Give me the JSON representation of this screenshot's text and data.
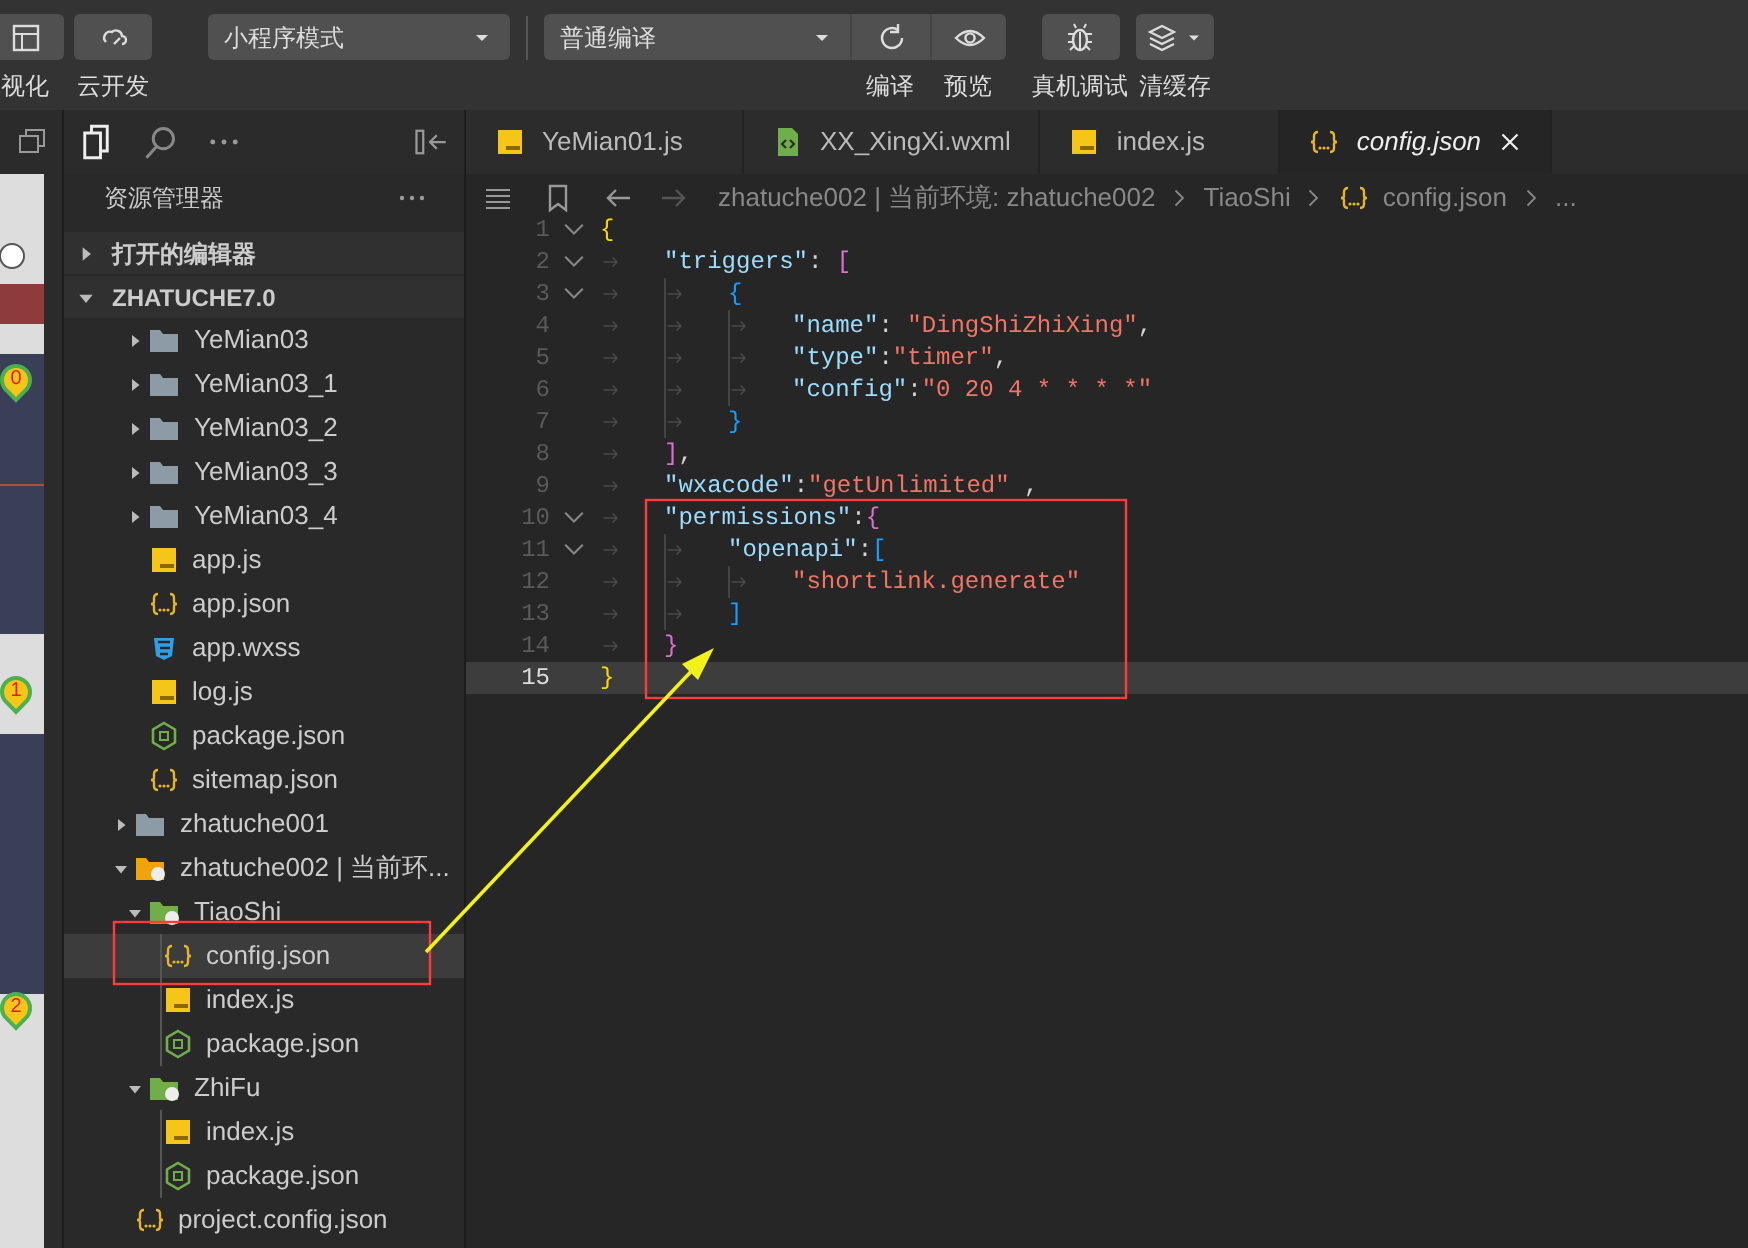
{
  "toolbar": {
    "tools": [
      {
        "kind": "button",
        "label": "视化"
      },
      {
        "kind": "button",
        "label": "云开发"
      },
      {
        "kind": "select",
        "value": "小程序模式"
      },
      {
        "kind": "compile",
        "value": "普通编译",
        "labels": [
          "编译",
          "预览"
        ]
      },
      {
        "kind": "button",
        "label": "真机调试"
      },
      {
        "kind": "button",
        "label": "清缓存"
      }
    ]
  },
  "simulator": {
    "markers": [
      "0",
      "1",
      "2"
    ]
  },
  "sidebar": {
    "title": "资源管理器",
    "sections": [
      {
        "label": "打开的编辑器",
        "expanded": false
      },
      {
        "label": "ZHATUCHE7.0",
        "expanded": true
      }
    ],
    "tree": [
      {
        "children": [
          {
            "label": "YeMian03",
            "kind": "folder",
            "expanded": false,
            "color": "#8d9ba6"
          },
          {
            "label": "YeMian03_1",
            "kind": "folder",
            "expanded": false,
            "color": "#8d9ba6"
          },
          {
            "label": "YeMian03_2",
            "kind": "folder",
            "expanded": false,
            "color": "#8d9ba6"
          },
          {
            "label": "YeMian03_3",
            "kind": "folder",
            "expanded": false,
            "color": "#8d9ba6"
          },
          {
            "label": "YeMian03_4",
            "kind": "folder",
            "expanded": false,
            "color": "#8d9ba6"
          },
          {
            "label": "app.js",
            "kind": "js"
          },
          {
            "label": "app.json",
            "kind": "json"
          },
          {
            "label": "app.wxss",
            "kind": "css"
          },
          {
            "label": "log.js",
            "kind": "js"
          },
          {
            "label": "package.json",
            "kind": "node"
          },
          {
            "label": "sitemap.json",
            "kind": "json"
          }
        ]
      },
      {
        "label": "zhatuche001",
        "kind": "folder",
        "expanded": false,
        "color": "#8d9ba6"
      },
      {
        "label": "zhatuche002 | 当前环...",
        "kind": "folder",
        "expanded": true,
        "color": "#f0a30a",
        "children": [
          {
            "label": "TiaoShi",
            "kind": "folder",
            "expanded": true,
            "color": "#6fae4a",
            "children": [
              {
                "label": "config.json",
                "kind": "json",
                "selected": true
              },
              {
                "label": "index.js",
                "kind": "js",
                "selected": false
              },
              {
                "label": "package.json",
                "kind": "node",
                "selected": false
              }
            ]
          },
          {
            "label": "ZhiFu",
            "kind": "folder",
            "expanded": true,
            "color": "#6fae4a",
            "children": [
              {
                "label": "index.js",
                "kind": "js",
                "selected": false
              },
              {
                "label": "package.json",
                "kind": "node",
                "selected": false
              }
            ]
          }
        ]
      },
      {
        "label": "project.config.json",
        "kind": "json"
      }
    ]
  },
  "tabs": [
    {
      "label": "YeMian01.js",
      "kind": "js",
      "selected": false
    },
    {
      "label": "XX_XingXi.wxml",
      "kind": "wxml",
      "selected": false
    },
    {
      "label": "index.js",
      "kind": "js",
      "selected": false
    },
    {
      "label": "config.json",
      "kind": "json",
      "selected": true
    }
  ],
  "breadcrumb": [
    {
      "label": "zhatuche002 | 当前环境: zhatuche002"
    },
    {
      "label": "TiaoShi"
    },
    {
      "label": "config.json",
      "kind": "json"
    },
    {
      "label": "..."
    }
  ],
  "editor": {
    "lines": [
      {
        "number": "1",
        "fold": true,
        "current": false,
        "tokens": [
          {
            "kind": "bracket",
            "text": "{",
            "color": "#ffd700"
          }
        ],
        "children": [
          {
            "number": "2",
            "fold": true,
            "current": false,
            "tokens": [
              {
                "kind": "key",
                "text": "\"triggers\""
              },
              {
                "kind": "punct",
                "text": ": "
              },
              {
                "kind": "bracket",
                "text": "[",
                "color": "#da70d6"
              }
            ],
            "children": [
              {
                "number": "3",
                "fold": true,
                "current": false,
                "tokens": [
                  {
                    "kind": "bracket",
                    "text": "{",
                    "color": "#179fff"
                  }
                ],
                "children": [
                  {
                    "number": "4",
                    "fold": false,
                    "current": false,
                    "tokens": [
                      {
                        "kind": "key",
                        "text": "\"name\""
                      },
                      {
                        "kind": "punct",
                        "text": ": "
                      },
                      {
                        "kind": "string",
                        "text": "\"DingShiZhiXing\""
                      },
                      {
                        "kind": "punct",
                        "text": ","
                      }
                    ]
                  },
                  {
                    "number": "5",
                    "fold": false,
                    "current": false,
                    "tokens": [
                      {
                        "kind": "key",
                        "text": "\"type\""
                      },
                      {
                        "kind": "punct",
                        "text": ":"
                      },
                      {
                        "kind": "string",
                        "text": "\"timer\""
                      },
                      {
                        "kind": "punct",
                        "text": ","
                      }
                    ]
                  },
                  {
                    "number": "6",
                    "fold": false,
                    "current": false,
                    "tokens": [
                      {
                        "kind": "key",
                        "text": "\"config\""
                      },
                      {
                        "kind": "punct",
                        "text": ":"
                      },
                      {
                        "kind": "string",
                        "text": "\"0 20 4 * * * *\""
                      }
                    ]
                  }
                ]
              },
              {
                "number": "7",
                "fold": false,
                "current": false,
                "tokens": [
                  {
                    "kind": "bracket",
                    "text": "}",
                    "color": "#179fff"
                  }
                ]
              }
            ]
          },
          {
            "number": "8",
            "fold": false,
            "current": false,
            "tokens": [
              {
                "kind": "bracket",
                "text": "]",
                "color": "#da70d6"
              },
              {
                "kind": "punct",
                "text": ","
              }
            ]
          },
          {
            "number": "9",
            "fold": false,
            "current": false,
            "tokens": [
              {
                "kind": "key",
                "text": "\"wxacode\""
              },
              {
                "kind": "punct",
                "text": ":"
              },
              {
                "kind": "string",
                "text": "\"getUnlimited\""
              },
              {
                "kind": "punct",
                "text": " ,"
              }
            ]
          },
          {
            "number": "10",
            "fold": true,
            "current": false,
            "tokens": [
              {
                "kind": "key",
                "text": "\"permissions\""
              },
              {
                "kind": "punct",
                "text": ":"
              },
              {
                "kind": "bracket",
                "text": "{",
                "color": "#da70d6"
              }
            ],
            "children": [
              {
                "number": "11",
                "fold": true,
                "current": false,
                "tokens": [
                  {
                    "kind": "key",
                    "text": "\"openapi\""
                  },
                  {
                    "kind": "punct",
                    "text": ":"
                  },
                  {
                    "kind": "bracket",
                    "text": "[",
                    "color": "#179fff"
                  }
                ],
                "children": [
                  {
                    "number": "12",
                    "fold": false,
                    "current": false,
                    "tokens": [
                      {
                        "kind": "string",
                        "text": "\"shortlink.generate\""
                      }
                    ]
                  }
                ]
              },
              {
                "number": "13",
                "fold": false,
                "current": false,
                "tokens": [
                  {
                    "kind": "bracket",
                    "text": "]",
                    "color": "#179fff"
                  }
                ]
              }
            ]
          },
          {
            "number": "14",
            "fold": false,
            "current": false,
            "tokens": [
              {
                "kind": "bracket",
                "text": "}",
                "color": "#da70d6"
              }
            ]
          }
        ]
      },
      {
        "number": "15",
        "fold": false,
        "current": true,
        "tokens": [
          {
            "kind": "bracket",
            "text": "}",
            "color": "#ffd700"
          }
        ]
      }
    ]
  }
}
